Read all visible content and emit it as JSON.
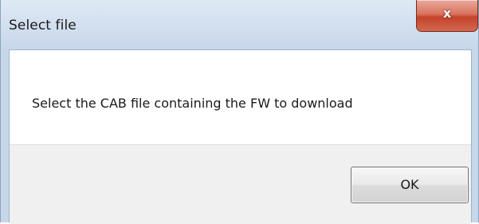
{
  "window": {
    "title": "Select file"
  },
  "titlebar": {
    "close_icon": "close-icon",
    "close_glyph": "x",
    "close_color": "#c4432b"
  },
  "dialog": {
    "message": "Select the CAB file containing the FW to download",
    "ok_label": "OK"
  }
}
